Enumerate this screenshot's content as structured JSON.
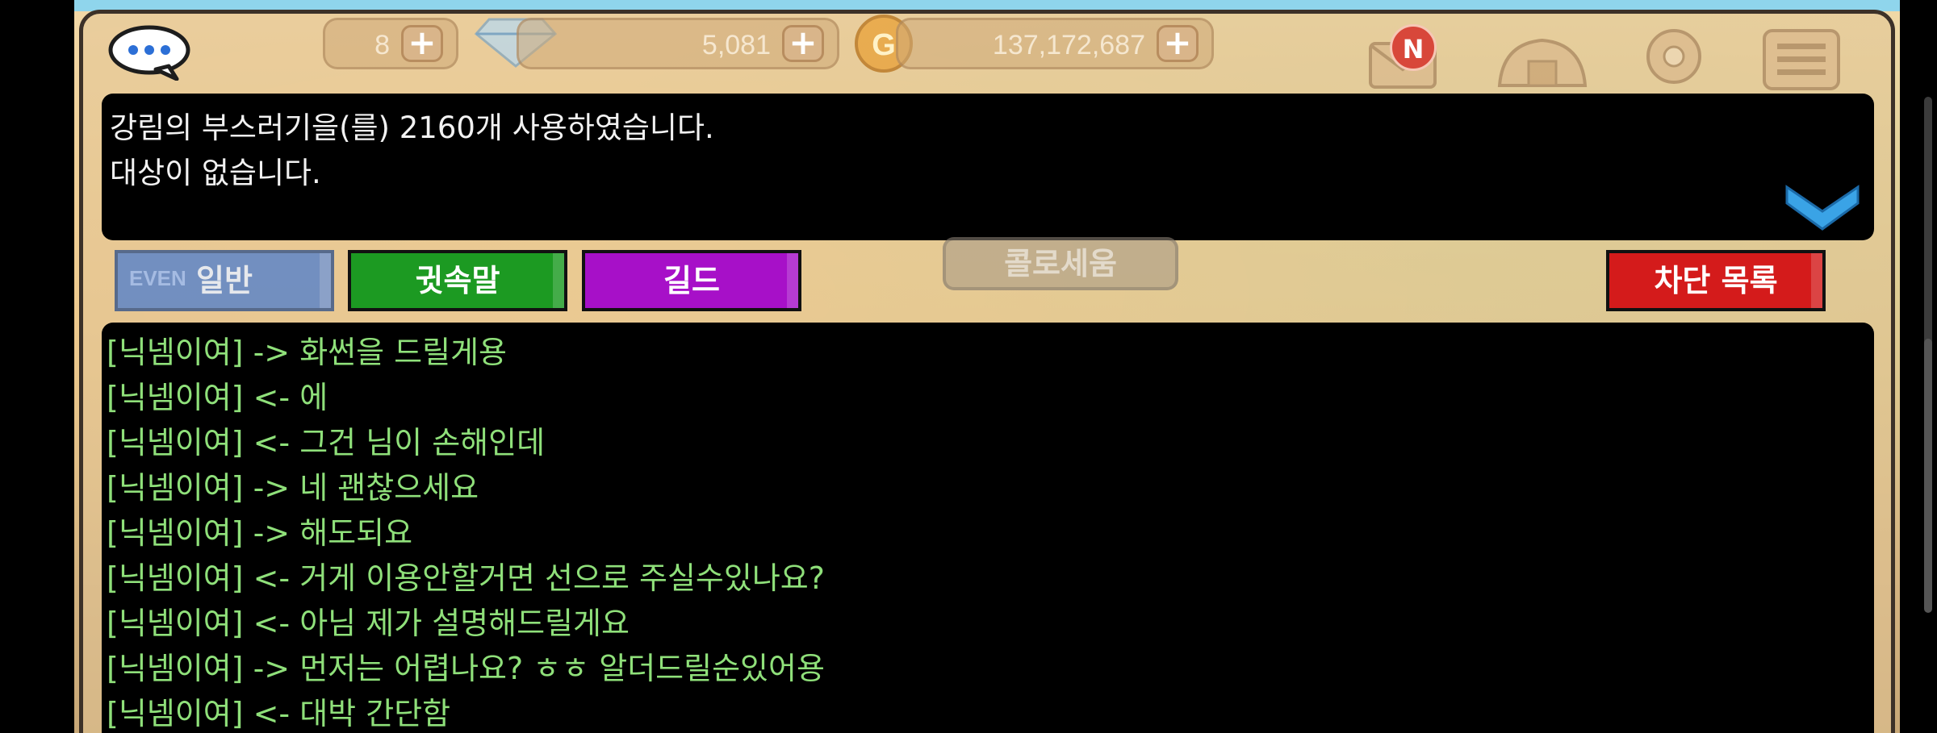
{
  "hud": {
    "hearts": "8",
    "diamonds": "5,081",
    "gold": "137,172,687",
    "mail_badge": "N"
  },
  "system": {
    "lines": [
      "강림의 부스러기을(를) 2160개 사용하였습니다.",
      "대상이 없습니다."
    ]
  },
  "tabs": {
    "normal": "일반",
    "whisper": "귓속말",
    "guild": "길드",
    "block": "차단 목록",
    "event": "EVEN"
  },
  "background": {
    "coliseum": "콜로세움"
  },
  "chat": {
    "lines": [
      "[닉넴이여] -> 화썬을 드릴게용",
      "[닉넴이여] <- 에",
      "[닉넴이여] <- 그건 님이 손해인데",
      "[닉넴이여] -> 네 괜찮으세요",
      "[닉넴이여] -> 해도되요",
      "[닉넴이여] <- 거게 이용안할거면 선으로 주실수있나요?",
      "[닉넴이여] <- 아님 제가 설명해드릴게요",
      "[닉넴이여] -> 먼저는 어렵나요? ㅎㅎ 알더드릴순있어용",
      "[닉넴이여] <- 대박 간단함"
    ]
  },
  "colors": {
    "chat_text": "#8fe07a",
    "system_text": "#f2f2f2",
    "tab_whisper": "#1c9a22",
    "tab_guild": "#a710c8",
    "tab_block": "#d41b1b",
    "tab_normal": "#5e86c8"
  },
  "icons": {
    "chat": "chat-bubble-icon",
    "heart_plus": "plus-icon",
    "diamond": "diamond-icon",
    "gold": "gold-coin-icon",
    "mail": "mail-icon",
    "shop": "shop-icon",
    "map": "map-pin-icon",
    "menu": "menu-icon",
    "collapse": "chevron-down-icon"
  }
}
